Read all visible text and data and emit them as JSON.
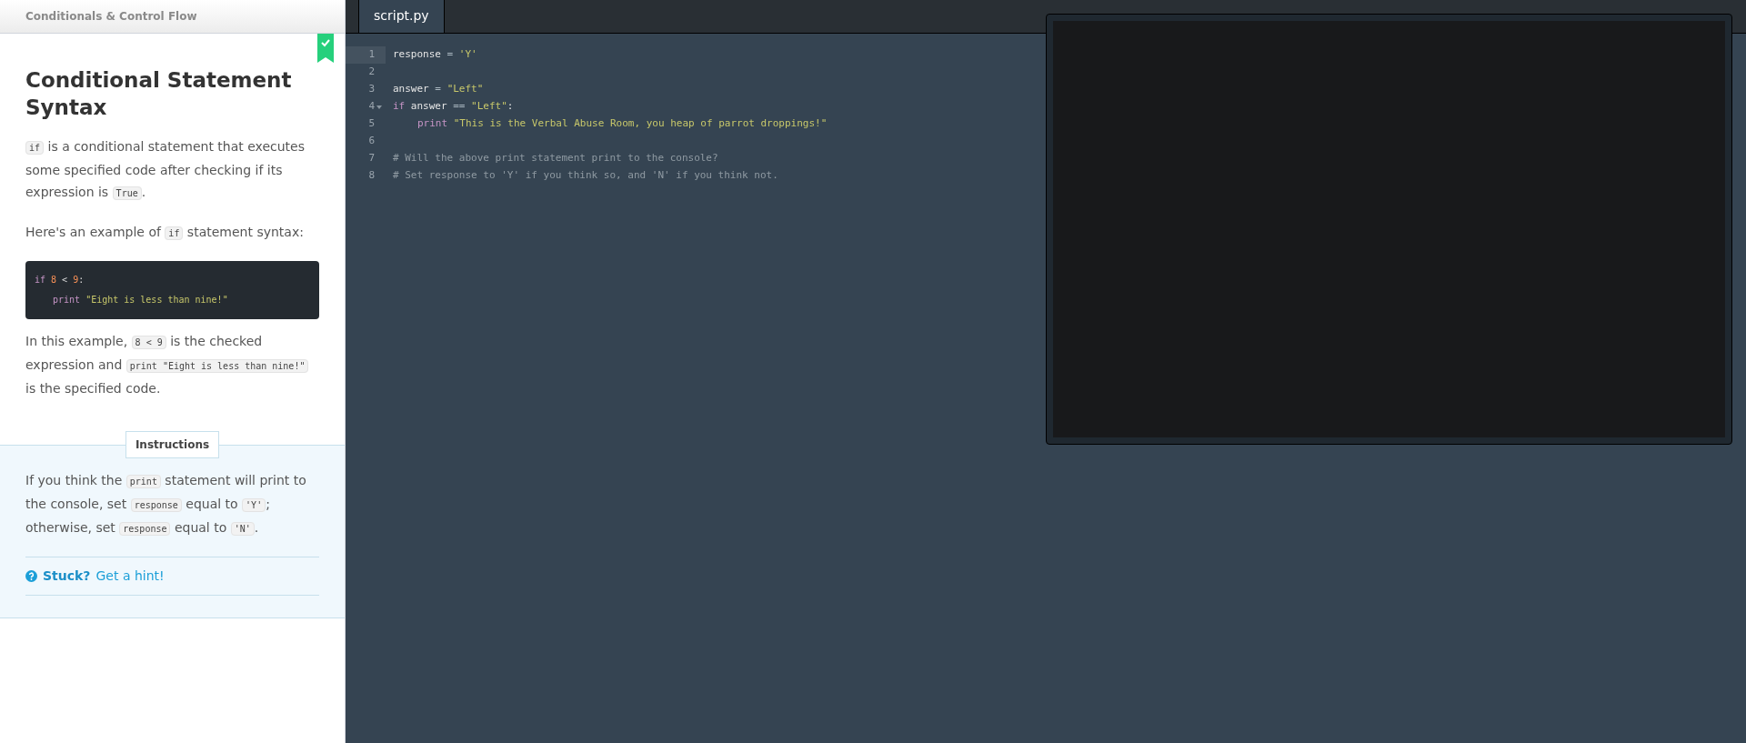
{
  "lesson": {
    "breadcrumb": "Conditionals & Control Flow",
    "completed": true,
    "title": "Conditional Statement Syntax",
    "paragraphs": [
      [
        {
          "kind": "code",
          "text": "if"
        },
        {
          "kind": "text",
          "text": " is a conditional statement that executes some specified code after checking if its expression is "
        },
        {
          "kind": "code",
          "text": "True"
        },
        {
          "kind": "text",
          "text": "."
        }
      ],
      [
        {
          "kind": "text",
          "text": "Here's an example of "
        },
        {
          "kind": "code",
          "text": "if"
        },
        {
          "kind": "text",
          "text": " statement syntax:"
        }
      ]
    ],
    "example": [
      [
        {
          "kind": "keyword",
          "text": "if "
        },
        {
          "kind": "number",
          "text": "8"
        },
        {
          "kind": "plain",
          "text": " < "
        },
        {
          "kind": "number",
          "text": "9"
        },
        {
          "kind": "plain",
          "text": ":"
        }
      ],
      {
        "indented": true,
        "tokens": [
          {
            "kind": "keyword",
            "text": "print "
          },
          {
            "kind": "string",
            "text": "\"Eight is less than nine!\""
          }
        ]
      }
    ],
    "after_paragraphs": [
      [
        {
          "kind": "text",
          "text": "In this example, "
        },
        {
          "kind": "code",
          "text": "8 < 9"
        },
        {
          "kind": "text",
          "text": " is the checked expression and "
        },
        {
          "kind": "code",
          "text": "print \"Eight is less than nine!\""
        },
        {
          "kind": "text",
          "text": " is the specified code."
        }
      ]
    ]
  },
  "instructions": {
    "label": "Instructions",
    "paragraph": [
      {
        "kind": "text",
        "text": "If you think the "
      },
      {
        "kind": "code",
        "text": "print"
      },
      {
        "kind": "text",
        "text": " statement will print to the console, set "
      },
      {
        "kind": "code",
        "text": "response"
      },
      {
        "kind": "text",
        "text": " equal to "
      },
      {
        "kind": "code",
        "text": "'Y'"
      },
      {
        "kind": "text",
        "text": "; otherwise, set "
      },
      {
        "kind": "code",
        "text": "response"
      },
      {
        "kind": "text",
        "text": " equal to "
      },
      {
        "kind": "code",
        "text": "'N'"
      },
      {
        "kind": "text",
        "text": "."
      }
    ],
    "hint_prompt": "Stuck?",
    "hint_link": "Get a hint!"
  },
  "editor": {
    "tabs": [
      {
        "label": "script.py",
        "selected": true
      }
    ],
    "lines": [
      {
        "number": "1",
        "active": true,
        "foldable": false,
        "tokens": [
          {
            "kind": "name",
            "text": "response"
          },
          {
            "kind": "op",
            "text": " = "
          },
          {
            "kind": "string",
            "text": "'Y'"
          }
        ]
      },
      {
        "number": "2",
        "active": false,
        "foldable": false
      },
      {
        "number": "3",
        "active": false,
        "foldable": false,
        "tokens": [
          {
            "kind": "name",
            "text": "answer"
          },
          {
            "kind": "op",
            "text": " = "
          },
          {
            "kind": "string",
            "text": "\"Left\""
          }
        ]
      },
      {
        "number": "4",
        "active": false,
        "foldable": true,
        "tokens": [
          {
            "kind": "keyword",
            "text": "if"
          },
          {
            "kind": "name",
            "text": " answer "
          },
          {
            "kind": "op",
            "text": "== "
          },
          {
            "kind": "string",
            "text": "\"Left\""
          },
          {
            "kind": "name",
            "text": ":"
          }
        ]
      },
      {
        "number": "5",
        "active": false,
        "foldable": false,
        "indented": true,
        "tokens": [
          {
            "kind": "keyword",
            "text": "print "
          },
          {
            "kind": "string",
            "text": "\"This is the Verbal Abuse Room, you heap of parrot droppings!\""
          }
        ]
      },
      {
        "number": "6",
        "active": false,
        "foldable": false
      },
      {
        "number": "7",
        "active": false,
        "foldable": false,
        "tokens": [
          {
            "kind": "comment",
            "text": "# Will the above print statement print to the console?"
          }
        ]
      },
      {
        "number": "8",
        "active": false,
        "foldable": false,
        "tokens": [
          {
            "kind": "comment",
            "text": "# Set response to 'Y' if you think so, and 'N' if you think not."
          }
        ]
      }
    ]
  }
}
